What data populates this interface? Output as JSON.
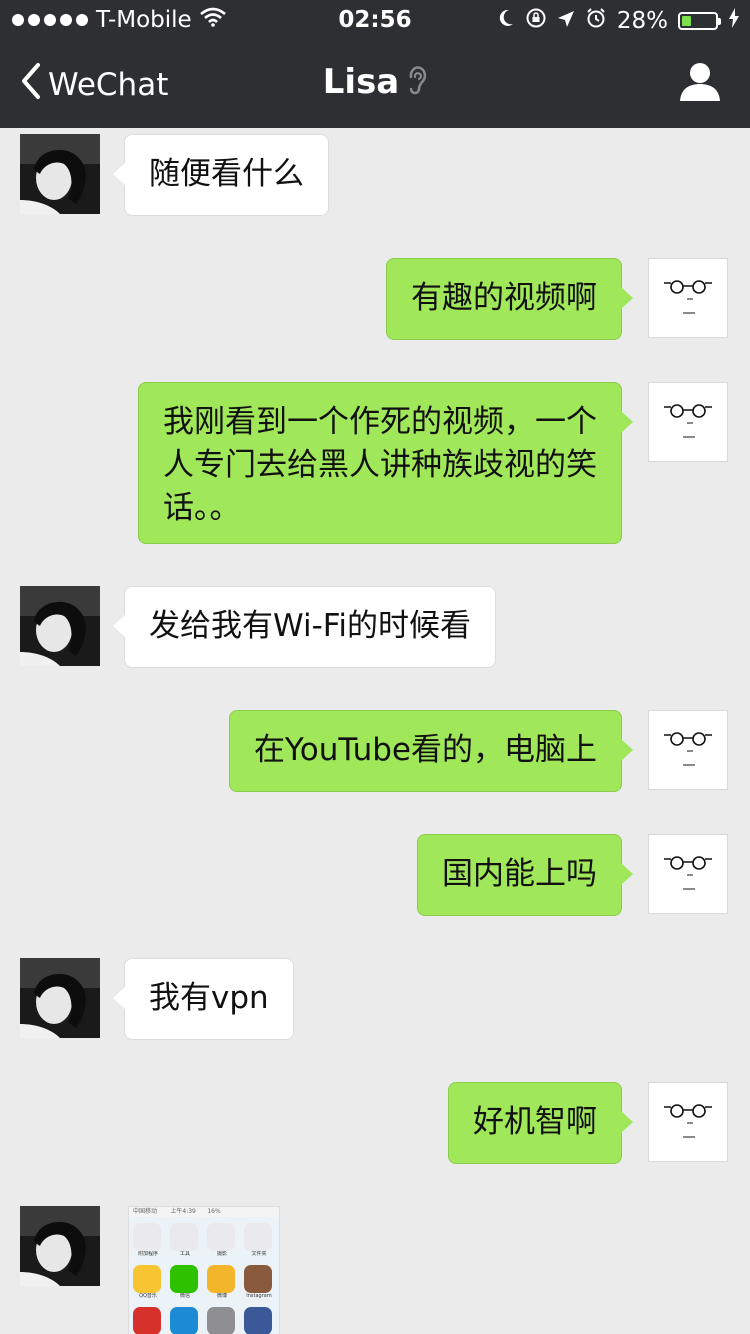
{
  "status_bar": {
    "carrier": "T-Mobile",
    "time": "02:56",
    "battery": "28%",
    "battery_level": 0.28
  },
  "nav": {
    "back_label": "WeChat",
    "title": "Lisa"
  },
  "messages": [
    {
      "side": "in",
      "text": "随便看什么"
    },
    {
      "side": "out",
      "text": "有趣的视频啊"
    },
    {
      "side": "out",
      "text": "我刚看到一个作死的视频，一个人专门去给黑人讲种族歧视的笑话。。"
    },
    {
      "side": "in",
      "text": "发给我有Wi-Fi的时候看"
    },
    {
      "side": "out",
      "text": "在YouTube看的，电脑上"
    },
    {
      "side": "out",
      "text": "国内能上吗"
    },
    {
      "side": "in",
      "text": "我有vpn"
    },
    {
      "side": "out",
      "text": "好机智啊"
    }
  ],
  "image_message": {
    "status_left": "中国移动",
    "status_time": "上午4:39",
    "status_right": "16%",
    "apps": [
      {
        "label": "附加程序",
        "color": "#e9e9ee"
      },
      {
        "label": "工具",
        "color": "#e9e9ee"
      },
      {
        "label": "摄影",
        "color": "#e9e9ee"
      },
      {
        "label": "文件夹",
        "color": "#e9e9ee"
      },
      {
        "label": "QQ音乐",
        "color": "#f7c531"
      },
      {
        "label": "微信",
        "color": "#2dc100"
      },
      {
        "label": "微博",
        "color": "#f3b62a"
      },
      {
        "label": "Instagram",
        "color": "#8a5a3c"
      },
      {
        "label": "",
        "color": "#d6312b"
      },
      {
        "label": "",
        "color": "#1c8bd3"
      },
      {
        "label": "",
        "color": "#8e8e93"
      },
      {
        "label": "",
        "color": "#3b5998"
      }
    ]
  }
}
